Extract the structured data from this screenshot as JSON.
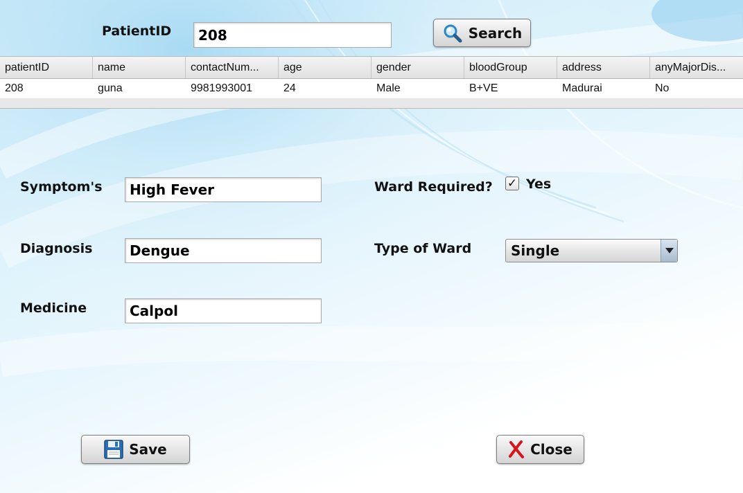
{
  "search": {
    "label": "PatientID",
    "value": "208",
    "button_label": "Search"
  },
  "table": {
    "columns": [
      "patientID",
      "name",
      "contactNum...",
      "age",
      "gender",
      "bloodGroup",
      "address",
      "anyMajorDis..."
    ],
    "rows": [
      [
        "208",
        "guna",
        "9981993001",
        "24",
        "Male",
        "B+VE",
        "Madurai",
        "No"
      ]
    ]
  },
  "form": {
    "symptoms_label": "Symptom's",
    "symptoms_value": "High Fever",
    "diagnosis_label": "Diagnosis",
    "diagnosis_value": "Dengue",
    "medicine_label": "Medicine",
    "medicine_value": "Calpol",
    "ward_required_label": "Ward Required?",
    "ward_required_checked": true,
    "ward_required_option": "Yes",
    "ward_type_label": "Type of Ward",
    "ward_type_value": "Single"
  },
  "actions": {
    "save_label": "Save",
    "close_label": "Close"
  },
  "icons": {
    "search": "magnifier-icon",
    "save": "floppy-disk-icon",
    "close": "red-x-icon",
    "dropdown": "chevron-down-icon",
    "check": "checkmark-icon"
  },
  "colors": {
    "background": "#d9f1fb",
    "close_icon": "#d7141a",
    "save_icon": "#2a6fb5"
  }
}
